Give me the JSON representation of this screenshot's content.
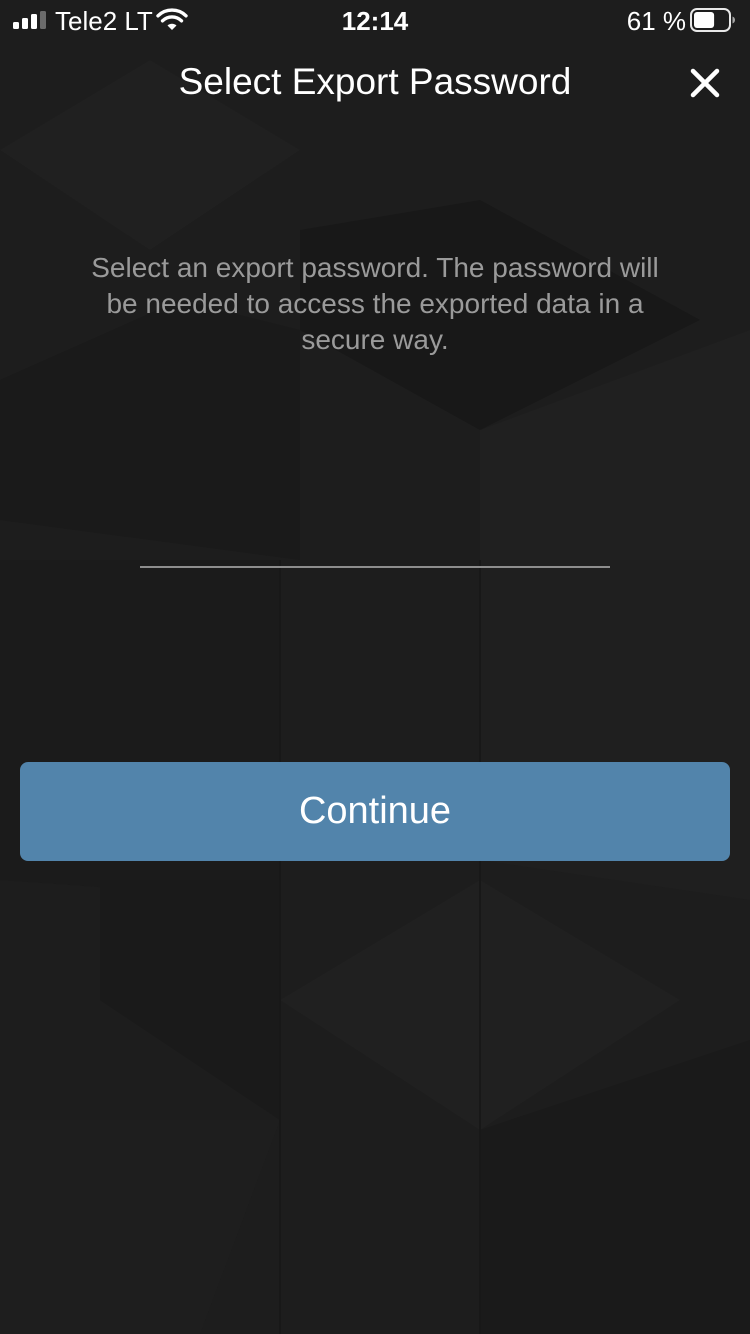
{
  "status_bar": {
    "carrier": "Tele2 LT",
    "time": "12:14",
    "battery_percent": "61 %",
    "battery_level": 0.61,
    "signal_bars_active": 3,
    "signal_bars_total": 4,
    "icons": [
      "signal-icon",
      "wifi-icon",
      "battery-icon"
    ]
  },
  "header": {
    "title": "Select Export Password",
    "close_icon": "close-icon"
  },
  "main": {
    "description": "Select an export password. The password will be needed to access the exported data in a secure way.",
    "password_value": "",
    "password_placeholder": ""
  },
  "actions": {
    "continue_label": "Continue"
  },
  "colors": {
    "background": "#1d1d1d",
    "button": "#5284ab",
    "text_primary": "#ffffff",
    "text_secondary": "#9a9a9a",
    "underline": "#8d8d8d"
  }
}
